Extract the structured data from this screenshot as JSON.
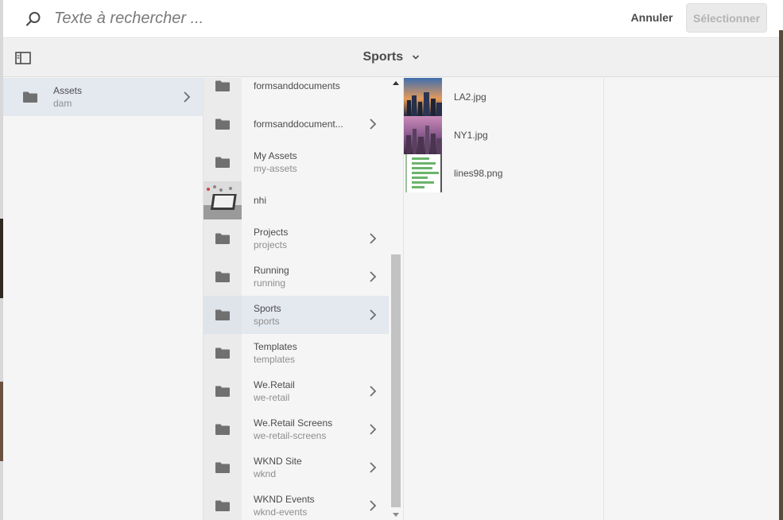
{
  "search": {
    "placeholder": "Texte à rechercher ...",
    "cancel_label": "Annuler",
    "select_label": "Sélectionner"
  },
  "header": {
    "title": "Sports"
  },
  "column1": [
    {
      "name": "Assets",
      "sub": "dam",
      "selected": true,
      "has_children": true
    }
  ],
  "column2": [
    {
      "name": "formsanddocuments",
      "sub": "",
      "has_children": false
    },
    {
      "name": "formsanddocument...",
      "sub": "",
      "has_children": true
    },
    {
      "name": "My Assets",
      "sub": "my-assets",
      "has_children": false
    },
    {
      "name": "nhi",
      "sub": "",
      "has_children": false,
      "thumbnail": true
    },
    {
      "name": "Projects",
      "sub": "projects",
      "has_children": true
    },
    {
      "name": "Running",
      "sub": "running",
      "has_children": true
    },
    {
      "name": "Sports",
      "sub": "sports",
      "has_children": true,
      "selected": true
    },
    {
      "name": "Templates",
      "sub": "templates",
      "has_children": false
    },
    {
      "name": "We.Retail",
      "sub": "we-retail",
      "has_children": true
    },
    {
      "name": "We.Retail Screens",
      "sub": "we-retail-screens",
      "has_children": true
    },
    {
      "name": "WKND Site",
      "sub": "wknd",
      "has_children": true
    },
    {
      "name": "WKND Events",
      "sub": "wknd-events",
      "has_children": true
    }
  ],
  "column3": [
    {
      "name": "LA2.jpg"
    },
    {
      "name": "NY1.jpg"
    },
    {
      "name": "lines98.png"
    }
  ],
  "colors": {
    "selected_row": "#e4e8ef",
    "panel": "#f5f5f5",
    "text": "#4b4b4b",
    "subtext": "#8e8e8e",
    "folder_icon": "#707070"
  }
}
